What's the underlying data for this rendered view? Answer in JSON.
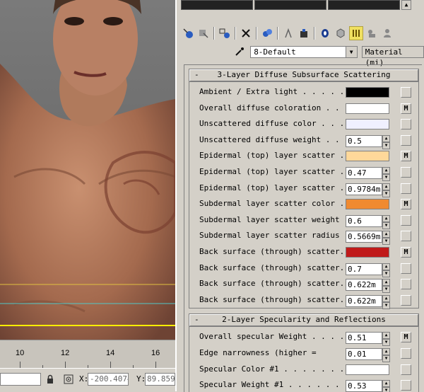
{
  "timeline": {
    "ticks": [
      "10",
      "12",
      "14",
      "16"
    ]
  },
  "statusbar": {
    "x_label": "X:",
    "x_value": "-200.4074",
    "y_label": "Y:",
    "y_value": "89.859"
  },
  "material": {
    "name": "8-Default",
    "type_button": "Material (mi)"
  },
  "icons": {
    "toolbar": [
      "get-material-icon",
      "put-to-scene-icon",
      "assign-material-icon",
      "delete-icon",
      "make-unique-icon",
      "put-to-library-icon",
      "material-effects-icon",
      "show-map-icon",
      "show-end-result-icon",
      "go-parent-icon",
      "go-sibling-icon",
      "pick-material-icon"
    ]
  },
  "rollout1": {
    "title": "3-Layer Diffuse Subsurface Scattering",
    "toggle": "-",
    "params": [
      {
        "label": "Ambient / Extra light . . . . . .",
        "kind": "color",
        "color": "#000000",
        "map": ""
      },
      {
        "label": "Overall diffuse coloration . . . .",
        "kind": "color",
        "color": "#ffffff",
        "map": "M"
      },
      {
        "label": "Unscattered diffuse color . . . .",
        "kind": "color",
        "color": "#f0f0ff",
        "map": ""
      },
      {
        "label": "Unscattered diffuse weight . . . .",
        "kind": "spinner",
        "value": "0.5",
        "map": ""
      },
      {
        "label": "Epidermal (top) layer scatter ...",
        "kind": "color",
        "color": "#ffd89a",
        "map": "M"
      },
      {
        "label": "Epidermal (top) layer scatter ...",
        "kind": "spinner",
        "value": "0.47",
        "map": ""
      },
      {
        "label": "Epidermal (top) layer scatter ...",
        "kind": "spinner",
        "value": "0.9784m",
        "map": ""
      },
      {
        "label": "Subdermal layer scatter color . .",
        "kind": "color",
        "color": "#f08a30",
        "map": "M"
      },
      {
        "label": "Subdermal layer scatter weight . .",
        "kind": "spinner",
        "value": "0.6",
        "map": ""
      },
      {
        "label": "Subdermal layer scatter radius . .",
        "kind": "spinner",
        "value": "0.5669m",
        "map": ""
      },
      {
        "label": "Back surface (through) scatter...",
        "kind": "color",
        "color": "#c01a1a",
        "map": "M"
      },
      {
        "label": "Back surface (through) scatter...",
        "kind": "spinner",
        "value": "0.7",
        "map": ""
      },
      {
        "label": "Back surface (through) scatter...",
        "kind": "spinner",
        "value": "0.622m",
        "map": ""
      },
      {
        "label": "Back surface (through) scatter...",
        "kind": "spinner",
        "value": "0.622m",
        "map": ""
      }
    ]
  },
  "rollout2": {
    "title": "2-Layer Specularity and Reflections",
    "toggle": "-",
    "params": [
      {
        "label": "Overall specular Weight . . . . .",
        "kind": "spinner",
        "value": "0.51",
        "map": "M"
      },
      {
        "label": "Edge narrowness (higher =",
        "kind": "spinner",
        "value": "0.01",
        "map": ""
      },
      {
        "label": "Specular Color #1 . . . . . . .",
        "kind": "color",
        "color": "#ffffff",
        "map": ""
      },
      {
        "label": "Specular Weight #1 . . . . . . .",
        "kind": "spinner",
        "value": "0.53",
        "map": ""
      }
    ]
  }
}
